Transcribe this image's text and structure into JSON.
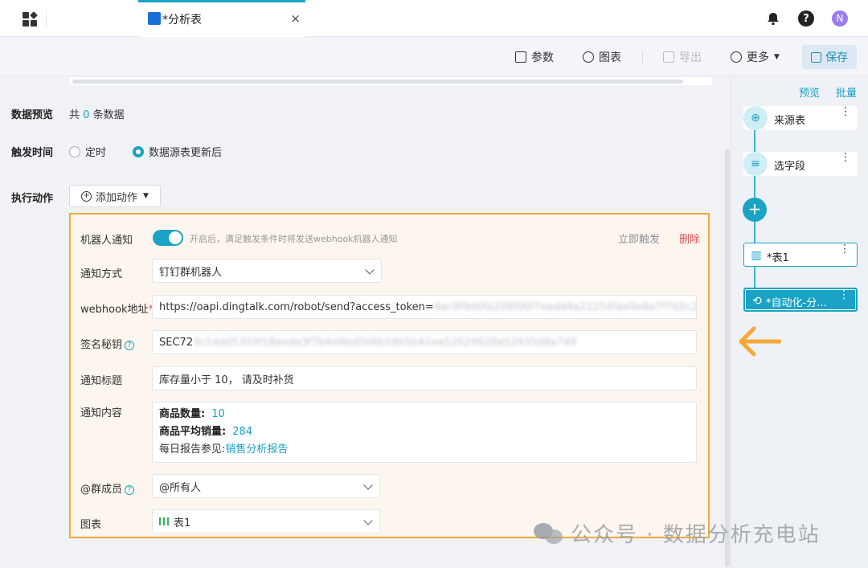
{
  "tab": {
    "label": "*分析表",
    "close": "×"
  },
  "header": {
    "avatar": "N",
    "help": "?"
  },
  "toolbar": {
    "params": "参数",
    "chart": "图表",
    "export": "导出",
    "more": "更多",
    "save": "保存"
  },
  "preview": {
    "label": "数据预览",
    "prefix": "共",
    "count": "0",
    "suffix": "条数据"
  },
  "trigger": {
    "label": "触发时间",
    "option_scheduled": "定时",
    "option_on_update": "数据源表更新后",
    "selected": "数据源表更新后"
  },
  "action": {
    "label": "执行动作",
    "add": "添加动作"
  },
  "robot": {
    "title": "机器人通知",
    "enabled": true,
    "hint": "开启后，满足触发条件时将发送webhook机器人通知",
    "trigger_now": "立即触发",
    "delete": "删除",
    "method_label": "通知方式",
    "method_value": "钉钉群机器人",
    "webhook_label": "webhook地址",
    "webhook_value": "https://oapi.dingtalk.com/robot/send?access_token=",
    "webhook_masked": "4ac0f9d0fa208f06f7eadd4a21254fae0e8a7f702c2757ca...",
    "secret_label": "签名秘钥",
    "secret_value": "SEC72",
    "secret_masked": "3c1ddd5303f18eeda3f7b4d4bd5b6b18b5b42ea52629628a52935d8a749",
    "subject_label": "通知标题",
    "subject_value": "库存量小于 10， 请及时补货",
    "content_label": "通知内容",
    "content": {
      "qty_label": "商品数量:",
      "qty_value": "10",
      "avg_label": "商品平均销量:",
      "avg_value": "284",
      "report_prefix": "每日报告参见:",
      "report_link": "销售分析报告"
    },
    "mention_label": "@群成员",
    "mention_value": "@所有人",
    "chart_label": "图表",
    "chart_value": "表1"
  },
  "pipeline": {
    "preview": "预览",
    "batch": "批量",
    "nodes": [
      "来源表",
      "选字段",
      "*表1",
      "*自动化-分..."
    ]
  },
  "watermark": "公众号 · 数据分析充电站",
  "colors": {
    "accent": "#1aa3c5",
    "highlight": "#f5a83a",
    "danger": "#e05252"
  }
}
